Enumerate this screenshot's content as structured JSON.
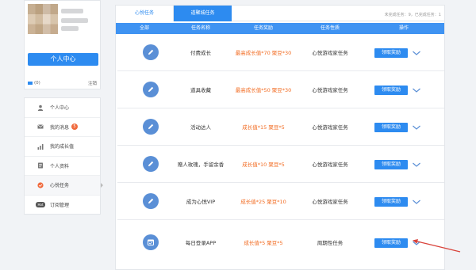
{
  "profile": {
    "center_button": "个人中心",
    "msg_count": "(0)",
    "logout": "注销"
  },
  "menu": {
    "items": [
      {
        "label": "个人中心",
        "icon": "user-icon"
      },
      {
        "label": "我的消息",
        "icon": "mail-icon",
        "badge": "5"
      },
      {
        "label": "我的成长值",
        "icon": "bar-chart-icon"
      },
      {
        "label": "个人资料",
        "icon": "profile-icon"
      },
      {
        "label": "心悦任务",
        "icon": "task-icon",
        "active": true
      },
      {
        "label": "订阅管理",
        "icon": "hot-icon",
        "hot": "Hot"
      }
    ]
  },
  "tabs": {
    "tab1": "心悦任务",
    "tab2": "道聚城任务"
  },
  "summary": "未完成任务：9，已完成任务：1",
  "table": {
    "headers": [
      "全部",
      "任务名称",
      "任务奖励",
      "任务性质",
      "操作"
    ],
    "rows": [
      {
        "name": "付费成长",
        "reward": "最高成长值*70 聚豆*30",
        "type": "心悦游戏家任务",
        "action": "领取奖励",
        "icon": "pencil-icon"
      },
      {
        "name": "道具收藏",
        "reward": "最高成长值*50 聚豆*30",
        "type": "心悦游戏家任务",
        "action": "领取奖励",
        "icon": "pencil-icon"
      },
      {
        "name": "活动达人",
        "reward": "成长值*15 聚豆*5",
        "type": "心悦游戏家任务",
        "action": "领取奖励",
        "icon": "pencil-icon"
      },
      {
        "name": "赠人玫瑰，手留余香",
        "reward": "成长值*10 聚豆*5",
        "type": "心悦游戏家任务",
        "action": "领取奖励",
        "icon": "pencil-icon"
      },
      {
        "name": "成为心悦VIP",
        "reward": "成长值*25 聚豆*10",
        "type": "心悦游戏家任务",
        "action": "领取奖励",
        "icon": "pencil-icon"
      },
      {
        "name": "每日登录APP",
        "reward": "成长值*5 聚豆*5",
        "type": "周期性任务",
        "action": "领取奖励",
        "icon": "calendar-icon"
      }
    ]
  },
  "colors": {
    "accent": "#2d8bf0",
    "header": "#3f93f2",
    "reward": "#f26b21",
    "annotation": "#d9433b"
  }
}
